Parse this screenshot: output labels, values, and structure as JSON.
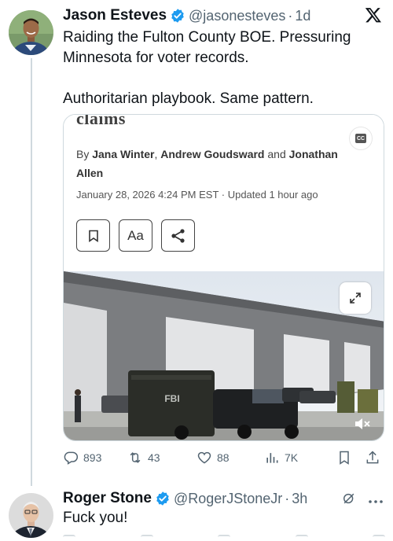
{
  "tweet1": {
    "name": "Jason Esteves",
    "handle": "@jasonesteves",
    "separator": "·",
    "time": "1d",
    "text_line1": "Raiding the Fulton County BOE. Pressuring",
    "text_line2": "Minnesota for voter records.",
    "text_line3": "Authoritarian playbook. Same pattern.",
    "card": {
      "headline": "claims",
      "byline_prefix": "By ",
      "author1": "Jana Winter",
      "sep1": ", ",
      "author2": "Andrew Goudsward",
      "sep2": " and ",
      "author3": "Jonathan Allen",
      "dateline": "January 28, 2026 4:24 PM EST · Updated 1 hour ago",
      "font_button_label": "Aa",
      "cc_label": "CC",
      "truck_label": "FBI"
    },
    "stats": {
      "replies": "893",
      "reposts": "43",
      "likes": "88",
      "views": "7K"
    }
  },
  "tweet2": {
    "name": "Roger Stone",
    "handle": "@RogerJStoneJr",
    "separator": "·",
    "time": "3h",
    "text": "Fuck you!"
  },
  "colors": {
    "text_primary": "#0f1419",
    "text_secondary": "#536471",
    "verified_blue": "#1d9bf0",
    "border": "#cfd9de",
    "grok_icon": "#536471"
  },
  "icons": {
    "verified": "verified-badge-icon",
    "x_logo": "x-logo-icon",
    "reply": "reply-icon",
    "repost": "repost-icon",
    "like": "heart-icon",
    "views": "views-icon",
    "bookmark": "bookmark-icon",
    "share": "share-icon",
    "expand": "expand-icon",
    "mute": "muted-speaker-icon",
    "grok": "grok-icon",
    "more": "more-icon"
  }
}
